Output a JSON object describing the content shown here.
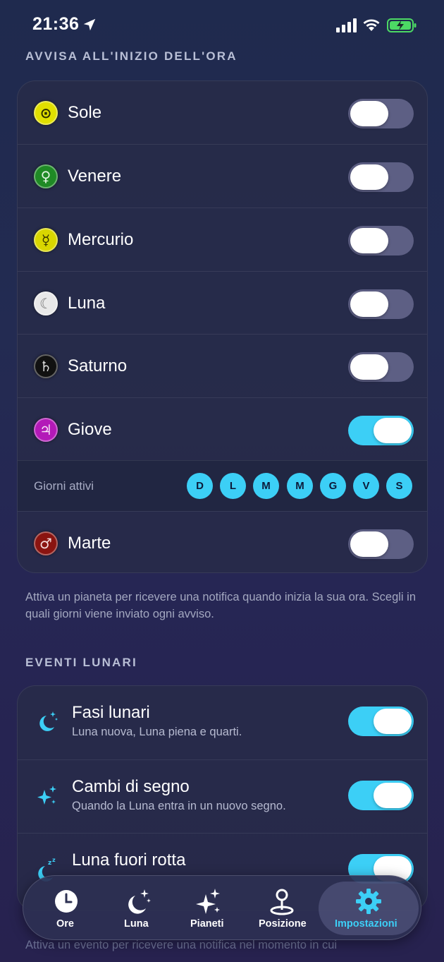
{
  "status_bar": {
    "time": "21:36"
  },
  "notify_section": {
    "title": "AVVISA ALL'INIZIO DELL'ORA",
    "planets": [
      {
        "name": "Sole",
        "symbol": "⊙",
        "color": "#e0df00",
        "on": false
      },
      {
        "name": "Venere",
        "symbol": "♀",
        "color": "#1f8a25",
        "on": false
      },
      {
        "name": "Mercurio",
        "symbol": "☿",
        "color": "#d9d600",
        "on": false
      },
      {
        "name": "Luna",
        "symbol": "☾",
        "color": "#e8e8e8",
        "on": false
      },
      {
        "name": "Saturno",
        "symbol": "♄",
        "color": "#111111",
        "on": false
      },
      {
        "name": "Giove",
        "symbol": "♃",
        "color": "#b319b8",
        "on": true
      },
      {
        "name": "Marte",
        "symbol": "♂",
        "color": "#8a1410",
        "on": false
      }
    ],
    "days_label": "Giorni attivi",
    "days": [
      "D",
      "L",
      "M",
      "M",
      "G",
      "V",
      "S"
    ],
    "footnote": "Attiva un pianeta per ricevere una notifica quando inizia la sua ora. Scegli in quali giorni viene inviato ogni avviso."
  },
  "lunar_section": {
    "title": "EVENTI LUNARI",
    "events": [
      {
        "title": "Fasi lunari",
        "subtitle": "Luna nuova, Luna piena e quarti.",
        "icon": "moon-stars-icon",
        "on": true
      },
      {
        "title": "Cambi di segno",
        "subtitle": "Quando la Luna entra in un nuovo segno.",
        "icon": "sparkles-icon",
        "on": true
      },
      {
        "title": "Luna fuori rotta",
        "subtitle": "",
        "icon": "moon-zzz-icon",
        "on": true
      }
    ],
    "footnote_partial": "Attiva un evento per ricevere una notifica nel momento in cui"
  },
  "tabbar": {
    "tabs": [
      {
        "label": "Ore",
        "icon": "clock-icon"
      },
      {
        "label": "Luna",
        "icon": "moon-stars-icon"
      },
      {
        "label": "Pianeti",
        "icon": "sparkles-icon"
      },
      {
        "label": "Posizione",
        "icon": "map-pin-icon"
      },
      {
        "label": "Impostazioni",
        "icon": "gear-icon",
        "active": true
      }
    ]
  },
  "colors": {
    "accent": "#3ccff6",
    "toggle_off": "#5d5f84"
  }
}
